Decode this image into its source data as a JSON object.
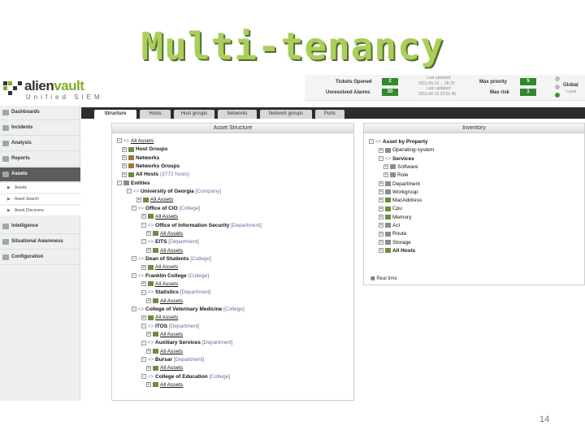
{
  "slide": {
    "title": "Multi-tenancy",
    "page_number": "14"
  },
  "logo": {
    "alien": "alien",
    "vault": "vault",
    "subtitle": "Unified SIEM"
  },
  "status": {
    "tickets_label": "Tickets Opened",
    "tickets_value": "2",
    "alarms_label": "Unresolved Alarms",
    "alarms_value": "20",
    "last_updated_1_label": "Last updated:",
    "last_updated_1": "2011-06-13 ... 26:25",
    "last_updated_2_label": "Last updated:",
    "last_updated_2": "2011-06-13 22:01:48",
    "max_priority_label": "Max priority",
    "max_priority_value": "5",
    "max_risk_label": "Max risk",
    "max_risk_value": "1",
    "global_label": "Global",
    "local_label": "Local"
  },
  "sidebar": {
    "sections": [
      {
        "label": "Dashboards"
      },
      {
        "label": "Incidents"
      },
      {
        "label": "Analysis"
      },
      {
        "label": "Reports"
      },
      {
        "label": "Assets"
      },
      {
        "label": "Intelligence"
      },
      {
        "label": "Situational Awareness"
      },
      {
        "label": "Configuration"
      }
    ],
    "asset_items": [
      {
        "label": "Assets"
      },
      {
        "label": "Asset Search"
      },
      {
        "label": "Asset Discovery"
      }
    ]
  },
  "tabs": [
    "Structure",
    "Hosts",
    "Host groups",
    "Networks",
    "Network groups",
    "Ports"
  ],
  "asset_structure": {
    "title": "Asset Structure",
    "rows": [
      {
        "text": "All Assets",
        "suffix": "",
        "style": "u"
      },
      {
        "text": "Host Groups",
        "suffix": "",
        "style": "b"
      },
      {
        "text": "Networks",
        "suffix": "",
        "style": "b"
      },
      {
        "text": "Networks Groups",
        "suffix": "",
        "style": "b"
      },
      {
        "text": "All Hosts",
        "suffix": "(3772 hosts)",
        "style": "b"
      },
      {
        "text": "Entities",
        "suffix": "",
        "style": "b"
      },
      {
        "text": "University of Georgia",
        "suffix": "[Company]",
        "style": "b"
      },
      {
        "text": "All Assets",
        "suffix": "",
        "style": "u"
      },
      {
        "text": "Office of CIO",
        "suffix": "[College]",
        "style": "b"
      },
      {
        "text": "All Assets",
        "suffix": "",
        "style": "u"
      },
      {
        "text": "Office of Information Security",
        "suffix": "[Department]",
        "style": "b"
      },
      {
        "text": "All Assets",
        "suffix": "",
        "style": "u"
      },
      {
        "text": "EITS",
        "suffix": "[Department]",
        "style": "b"
      },
      {
        "text": "All Assets",
        "suffix": "",
        "style": "u"
      },
      {
        "text": "Dean of Students",
        "suffix": "[College]",
        "style": "b"
      },
      {
        "text": "All Assets",
        "suffix": "",
        "style": "u"
      },
      {
        "text": "Franklin College",
        "suffix": "[College]",
        "style": "b"
      },
      {
        "text": "All Assets",
        "suffix": "",
        "style": "u"
      },
      {
        "text": "Statistics",
        "suffix": "[Department]",
        "style": "b"
      },
      {
        "text": "All Assets",
        "suffix": "",
        "style": "u"
      },
      {
        "text": "College of Veterinary Medicine",
        "suffix": "[College]",
        "style": "b"
      },
      {
        "text": "All Assets",
        "suffix": "",
        "style": "u"
      },
      {
        "text": "ITOS",
        "suffix": "[Department]",
        "style": "b"
      },
      {
        "text": "All Assets",
        "suffix": "",
        "style": "u"
      },
      {
        "text": "Auxiliary Services",
        "suffix": "[Department]",
        "style": "b"
      },
      {
        "text": "All Assets",
        "suffix": "",
        "style": "u"
      },
      {
        "text": "Bursar",
        "suffix": "[Department]",
        "style": "b"
      },
      {
        "text": "All Assets",
        "suffix": "",
        "style": "u"
      },
      {
        "text": "College of Education",
        "suffix": "[College]",
        "style": "b"
      },
      {
        "text": "All Assets",
        "suffix": "",
        "style": "u"
      }
    ]
  },
  "inventory": {
    "title": "Inventory",
    "rows": [
      {
        "text": "Asset by Property"
      },
      {
        "text": "Operating-system"
      },
      {
        "text": "Services"
      },
      {
        "text": "Software"
      },
      {
        "text": "Role"
      },
      {
        "text": "Department"
      },
      {
        "text": "Workgroup"
      },
      {
        "text": "MacAddress"
      },
      {
        "text": "Cpu"
      },
      {
        "text": "Memory"
      },
      {
        "text": "Acl"
      },
      {
        "text": "Route"
      },
      {
        "text": "Storage"
      },
      {
        "text": "All Hosts"
      }
    ],
    "realtime_label": "Real time"
  },
  "colors": {
    "accent_green": "#2f8a2c",
    "title_green": "#a9cf5a",
    "dark_nav": "#2c2c2c"
  }
}
